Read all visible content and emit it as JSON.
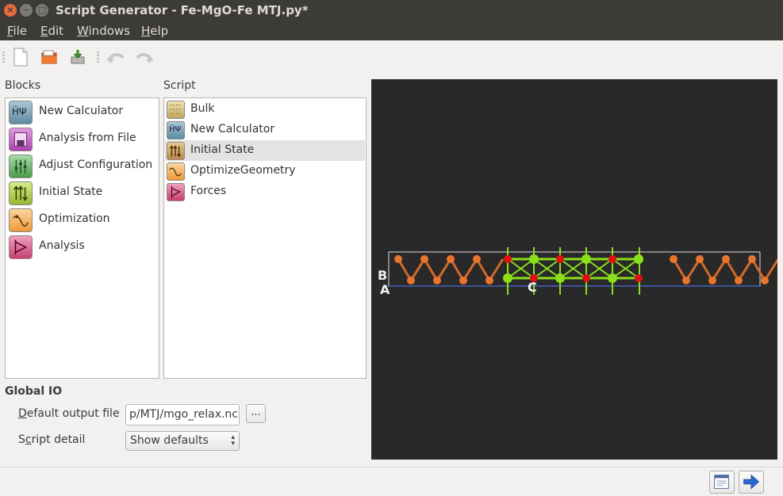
{
  "window": {
    "title": "Script Generator - Fe-MgO-Fe MTJ.py*",
    "close_glyph": "×",
    "minimize_glyph": "−",
    "maximize_glyph": "□"
  },
  "menu": {
    "items": [
      {
        "label": "File",
        "u": "F",
        "rest": "ile"
      },
      {
        "label": "Edit",
        "u": "E",
        "rest": "dit"
      },
      {
        "label": "Windows",
        "u": "W",
        "rest": "indows"
      },
      {
        "label": "Help",
        "u": "H",
        "rest": "elp"
      }
    ]
  },
  "toolbar": {
    "icons": [
      "new-document-icon",
      "open-folder-icon",
      "save-icon",
      "undo-icon",
      "redo-icon"
    ]
  },
  "blocks": {
    "header": "Blocks",
    "items": [
      {
        "label": "New Calculator",
        "icon": "calculator-icon",
        "color": "#6f9bb4",
        "glyph": "ĤΨ"
      },
      {
        "label": "Analysis from File",
        "icon": "analysis-file-icon",
        "color": "#c04ec0",
        "glyph": ""
      },
      {
        "label": "Adjust Configuration",
        "icon": "adjust-config-icon",
        "color": "#5aa65a",
        "glyph": ""
      },
      {
        "label": "Initial State",
        "icon": "initial-state-icon",
        "color": "#a8c83a",
        "glyph": "↑↑↓"
      },
      {
        "label": "Optimization",
        "icon": "optimization-icon",
        "color": "#f0a040",
        "glyph": ""
      },
      {
        "label": "Analysis",
        "icon": "analysis-icon",
        "color": "#d05080",
        "glyph": ""
      }
    ]
  },
  "script": {
    "header": "Script",
    "items": [
      {
        "label": "Bulk",
        "icon": "bulk-icon",
        "color": "#c8b870",
        "selected": false
      },
      {
        "label": "New Calculator",
        "icon": "calculator-icon",
        "color": "#6f9bb4",
        "selected": false
      },
      {
        "label": "Initial State",
        "icon": "initial-state-icon",
        "color": "#c8a060",
        "selected": true
      },
      {
        "label": "OptimizeGeometry",
        "icon": "optimization-icon",
        "color": "#f0a040",
        "selected": false
      },
      {
        "label": "Forces",
        "icon": "forces-icon",
        "color": "#d05080",
        "selected": false
      }
    ]
  },
  "global_io": {
    "title": "Global IO",
    "output_label": "Default output file",
    "output_label_u": "D",
    "output_label_rest": "efault output file",
    "output_value": "p/MTJ/mgo_relax.nc",
    "browse_label": "...",
    "detail_label": "Script detail",
    "detail_label_pre": "S",
    "detail_label_u": "c",
    "detail_label_rest": "ript detail",
    "detail_value": "Show defaults"
  },
  "viewer": {
    "background": "#292929",
    "axis_labels": {
      "b": "B",
      "a": "A",
      "c": "C"
    }
  },
  "statusbar": {
    "icons": [
      "script-view-icon",
      "send-arrow-icon"
    ]
  }
}
